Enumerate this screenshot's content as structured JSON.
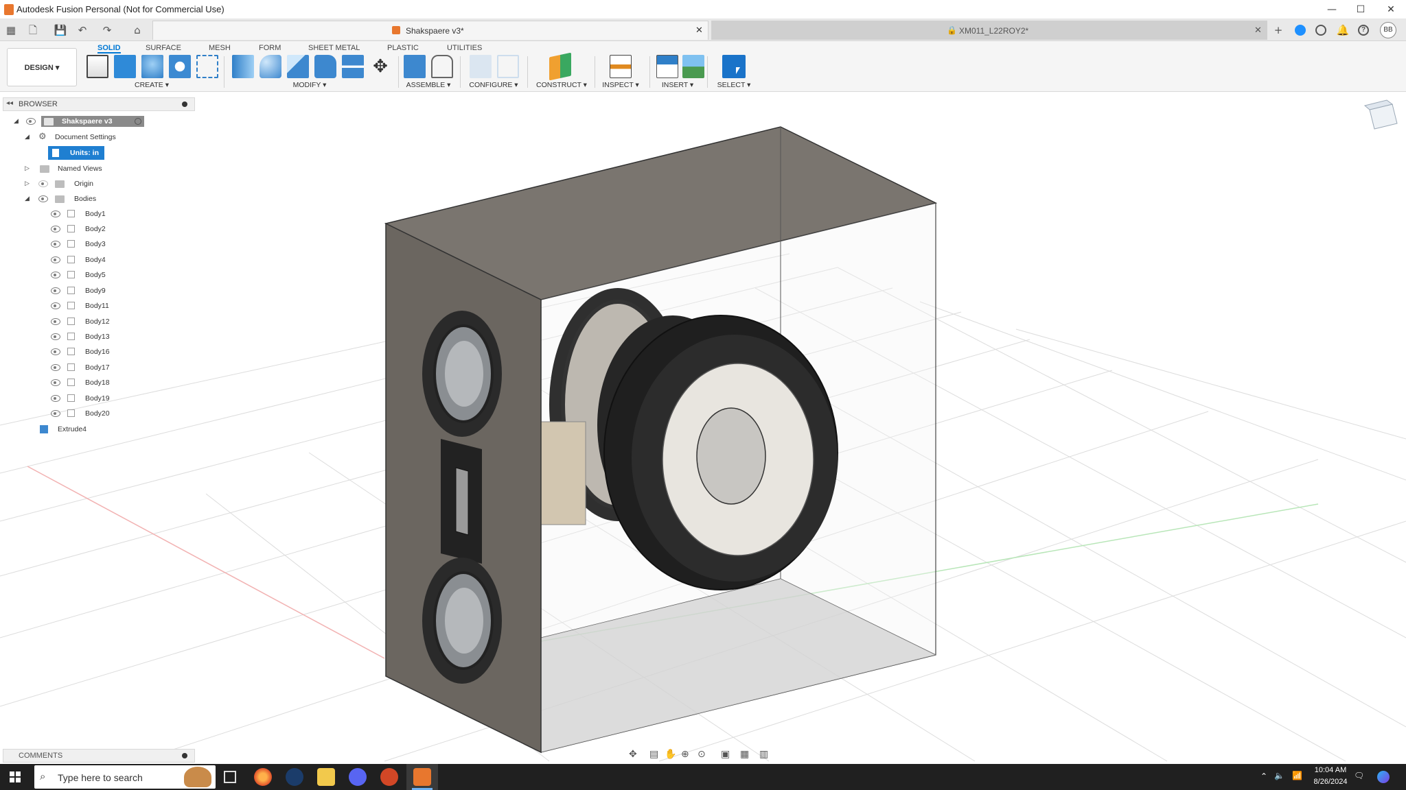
{
  "window": {
    "title": "Autodesk Fusion Personal (Not for Commercial Use)",
    "minimize": "—",
    "maximize": "☐",
    "close": "✕"
  },
  "tabs": [
    {
      "label": "Shakspaere v3*",
      "active": true
    },
    {
      "label": "XM011_L22ROY2*",
      "active": false
    }
  ],
  "user_initials": "BB",
  "workspace": {
    "label": "DESIGN",
    "tabs": [
      "SOLID",
      "SURFACE",
      "MESH",
      "FORM",
      "SHEET METAL",
      "PLASTIC",
      "UTILITIES"
    ],
    "active_tab": "SOLID"
  },
  "toolbar_groups": [
    {
      "label": "CREATE ▾"
    },
    {
      "label": "MODIFY ▾"
    },
    {
      "label": "ASSEMBLE ▾"
    },
    {
      "label": "CONFIGURE ▾"
    },
    {
      "label": "CONSTRUCT ▾"
    },
    {
      "label": "INSPECT ▾"
    },
    {
      "label": "INSERT ▾"
    },
    {
      "label": "SELECT ▾"
    }
  ],
  "browser": {
    "header": "BROWSER",
    "root": "Shakspaere v3",
    "document_settings": "Document Settings",
    "units": "Units: in",
    "named_views": "Named Views",
    "origin": "Origin",
    "bodies_folder": "Bodies",
    "bodies": [
      "Body1",
      "Body2",
      "Body3",
      "Body4",
      "Body5",
      "Body9",
      "Body11",
      "Body12",
      "Body13",
      "Body16",
      "Body17",
      "Body18",
      "Body19",
      "Body20"
    ],
    "extrude": "Extrude4"
  },
  "comments": {
    "label": "COMMENTS"
  },
  "taskbar": {
    "search_placeholder": "Type here to search",
    "time": "10:04 AM",
    "date": "8/26/2024"
  },
  "colors": {
    "accent": "#0078d4",
    "box_face": "#6b6660",
    "box_top": "#7a756f",
    "taskbar": "#202020"
  }
}
